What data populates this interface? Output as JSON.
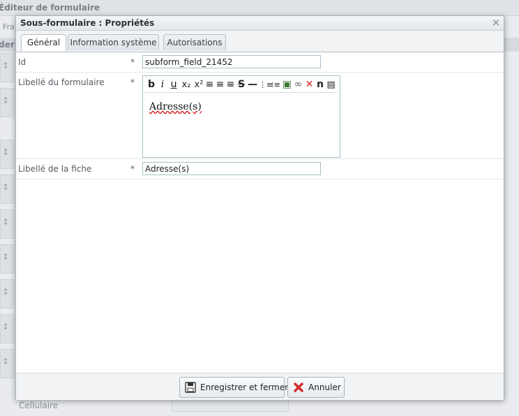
{
  "background": {
    "title": "Éditeur de formulaire",
    "tab_label": "Fra",
    "bar_label": "der",
    "bottom_label": "Cellulaire"
  },
  "dialog": {
    "title": "Sous-formulaire : Propriétés",
    "tabs": [
      {
        "label": "Général",
        "active": true
      },
      {
        "label": "Information système",
        "active": false
      },
      {
        "label": "Autorisations",
        "active": false
      }
    ],
    "fields": {
      "id": {
        "label": "Id",
        "required_mark": "*",
        "value": "subform_field_21452"
      },
      "form_label": {
        "label": "Libellé du formulaire",
        "required_mark": "*",
        "value": "Adresse(s)"
      },
      "record_label": {
        "label": "Libellé de la fiche",
        "required_mark": "*",
        "value": "Adresse(s)"
      }
    },
    "editor_toolbar": [
      {
        "name": "bold",
        "glyph": "b"
      },
      {
        "name": "italic",
        "glyph": "i"
      },
      {
        "name": "underline",
        "glyph": "u"
      },
      {
        "name": "subscript",
        "glyph": "x₂"
      },
      {
        "name": "superscript",
        "glyph": "x²"
      },
      {
        "name": "align-left",
        "glyph": "≡"
      },
      {
        "name": "align-center",
        "glyph": "≡"
      },
      {
        "name": "align-right",
        "glyph": "≡"
      },
      {
        "name": "strikethrough",
        "glyph": "S"
      },
      {
        "name": "horizontal-rule",
        "glyph": "—"
      },
      {
        "name": "ordered-list",
        "glyph": "⋮≡"
      },
      {
        "name": "unordered-list",
        "glyph": "⁝≡"
      },
      {
        "name": "image",
        "glyph": "▣"
      },
      {
        "name": "link",
        "glyph": "∞"
      },
      {
        "name": "unlink",
        "glyph": "✕"
      },
      {
        "name": "nbsp",
        "glyph": "n"
      },
      {
        "name": "source",
        "glyph": "▤"
      }
    ],
    "buttons": {
      "save": "Enregistrer et fermer",
      "cancel": "Annuler"
    },
    "close_glyph": "×"
  },
  "colors": {
    "accent_cancel": "#d42a2a",
    "input_border": "#a7bdc9"
  }
}
